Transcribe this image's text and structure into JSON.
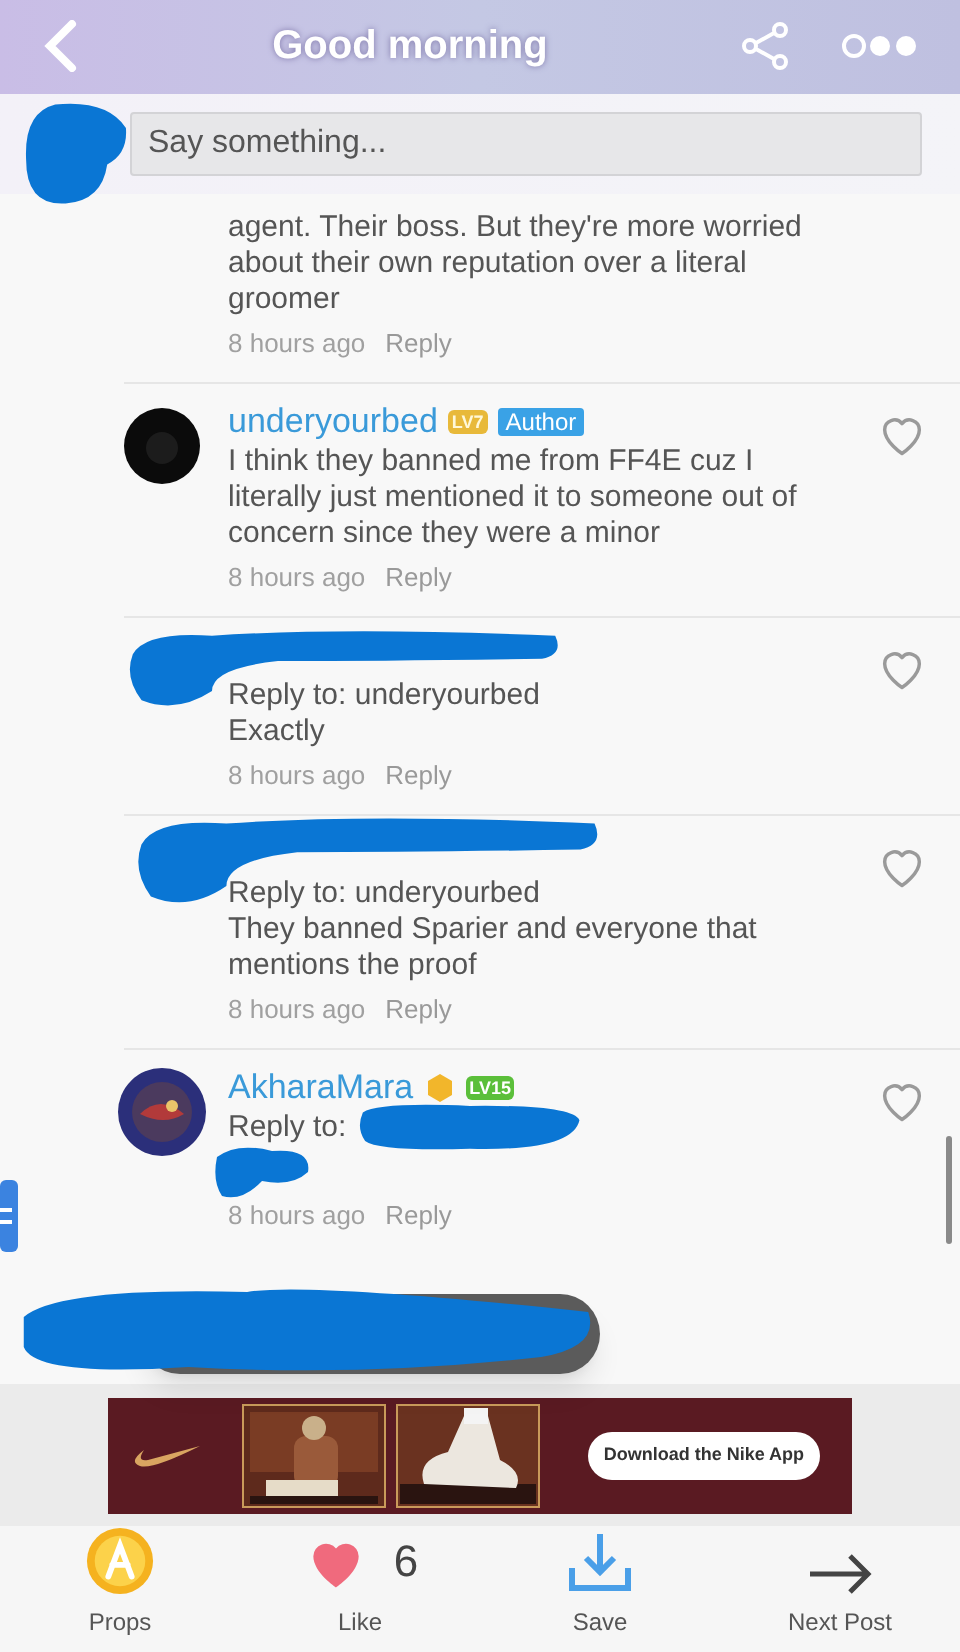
{
  "header": {
    "title": "Good morning"
  },
  "composer": {
    "placeholder": "Say something..."
  },
  "comments": [
    {
      "kind": "continued",
      "body": "agent. Their boss. But they're more worried about their own reputation over a literal groomer",
      "time": "8 hours ago",
      "reply_label": "Reply"
    },
    {
      "kind": "full",
      "author": "underyourbed",
      "level_badge": "LV7",
      "role_tag": "Author",
      "body": "I think they banned me from FF4E cuz I literally just mentioned it to someone out of concern since they were a minor",
      "time": "8 hours ago",
      "reply_label": "Reply",
      "liked": false
    },
    {
      "kind": "redacted",
      "reply_to": "Reply to: underyourbed",
      "body": "Exactly",
      "time": "8 hours ago",
      "reply_label": "Reply",
      "liked": false
    },
    {
      "kind": "redacted",
      "reply_to": "Reply to: underyourbed",
      "body": "They banned Sparier and everyone that mentions the proof",
      "time": "8 hours ago",
      "reply_label": "Reply",
      "liked": false
    },
    {
      "kind": "full",
      "author": "AkharaMara",
      "level_badge": "LV15",
      "reply_to": "Reply to:",
      "time": "8 hours ago",
      "reply_label": "Reply",
      "liked": false
    }
  ],
  "ad": {
    "button": "Download the Nike App"
  },
  "bottom_bar": [
    {
      "kind": "props",
      "label": "Props"
    },
    {
      "kind": "like",
      "label": "Like",
      "count": "6",
      "liked": true
    },
    {
      "kind": "save",
      "label": "Save"
    },
    {
      "kind": "next",
      "label": "Next Post"
    }
  ]
}
